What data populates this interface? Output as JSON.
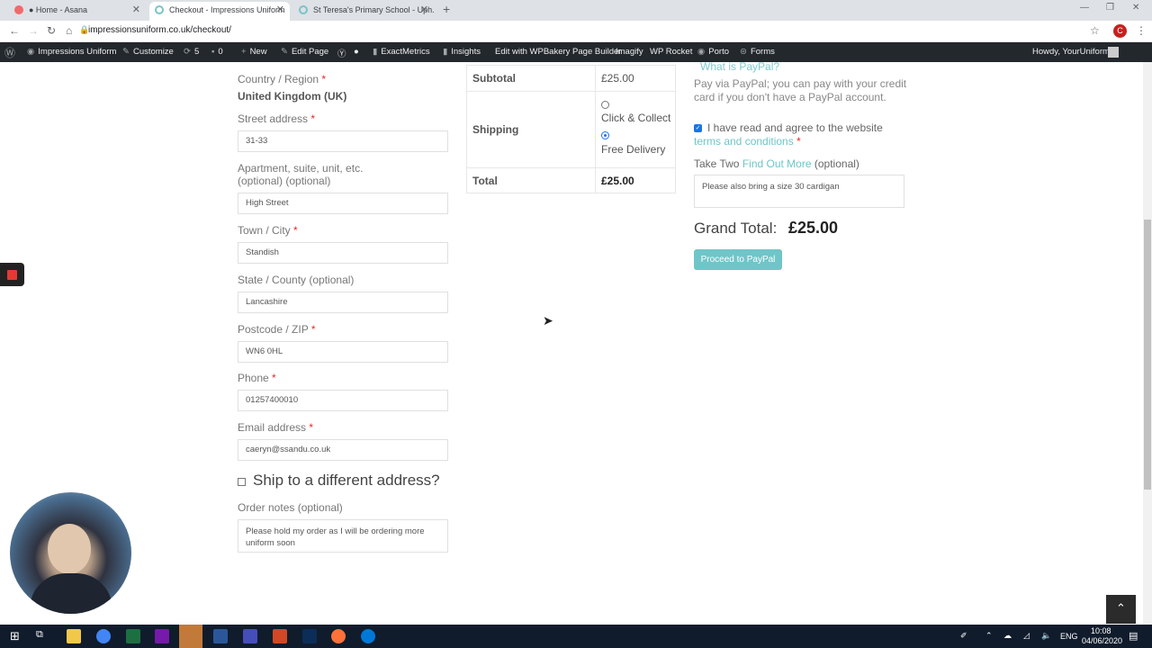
{
  "browser": {
    "tabs": [
      {
        "title": "● Home - Asana",
        "fav_color": "#f06a6a"
      },
      {
        "title": "Checkout - Impressions Uniform",
        "fav_color": "#7ac4c7"
      },
      {
        "title": "St Teresa's Primary School - Uph...",
        "fav_color": "#7ac4c7"
      }
    ],
    "new_tab": "+",
    "url": "impressionsuniform.co.uk/checkout/",
    "profile_initial": "C"
  },
  "adminbar": {
    "items": [
      "Impressions Uniform",
      "Customize",
      "5",
      "0",
      "New",
      "Edit Page",
      "ExactMetrics",
      "Insights",
      "Edit with WPBakery Page Builder",
      "Imagify",
      "WP Rocket",
      "Porto",
      "Forms"
    ],
    "howdy": "Howdy, YourUniform"
  },
  "billing": {
    "country_label": "Country / Region",
    "country_value": "United Kingdom (UK)",
    "street_label": "Street address",
    "street_value": "31-33",
    "apartment_label_1": "Apartment, suite, unit, etc.",
    "apartment_label_2": "(optional) (optional)",
    "apartment_value": "High Street",
    "town_label": "Town / City",
    "town_value": "Standish",
    "state_label": "State / County (optional)",
    "state_value": "Lancashire",
    "postcode_label": "Postcode / ZIP",
    "postcode_value": "WN6 0HL",
    "phone_label": "Phone",
    "phone_value": "01257400010",
    "email_label": "Email address",
    "email_value": "caeryn@ssandu.co.uk",
    "ship_different": "Ship to a different address?",
    "notes_label": "Order notes (optional)",
    "notes_value": "Please hold my order as I will be ordering more uniform soon",
    "required_mark": "*"
  },
  "order": {
    "subtotal_label": "Subtotal",
    "subtotal_value": "£25.00",
    "shipping_label": "Shipping",
    "shipping_options": [
      "Click & Collect",
      "Free Delivery"
    ],
    "shipping_selected": "Free Delivery",
    "total_label": "Total",
    "total_value": "£25.00"
  },
  "payment": {
    "paypal_link": "What is PayPal?",
    "paypal_desc_1": "Pay via PayPal; you can pay with your credit",
    "paypal_desc_2": "card if you don't have a PayPal account.",
    "terms_text": "I have read and agree to the website",
    "terms_link": "terms and conditions",
    "take_two_text": "Take Two",
    "find_out_more": "Find Out More",
    "optional": "(optional)",
    "take_two_value": "Please also bring a size 30 cardigan",
    "grand_total_label": "Grand Total:",
    "grand_total_value": "£25.00",
    "proceed_button": "Proceed to PayPal"
  },
  "taskbar": {
    "lang": "ENG",
    "time": "10:08",
    "date": "04/06/2020"
  },
  "colors": {
    "accent": "#6fc5c8",
    "required": "#e02b27",
    "adminbar": "#23282d",
    "taskbar": "#101c2c"
  }
}
